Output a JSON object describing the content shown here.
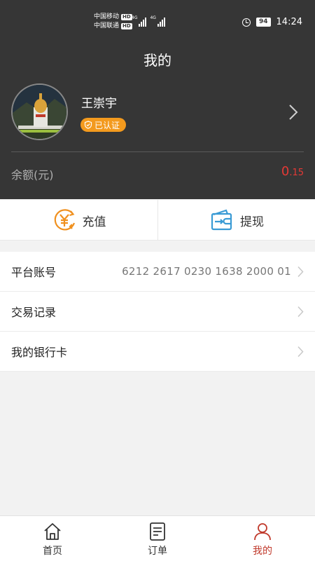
{
  "status_bar": {
    "carrier_1": "中国移动",
    "carrier_2": "中国联通",
    "hd_1": "HD",
    "hd_2": "HD",
    "network_1": "4G",
    "network_2": "4G",
    "battery": "94",
    "time": "14:24"
  },
  "header": {
    "title": "我的"
  },
  "profile": {
    "name": "王崇宇",
    "verified_label": "已认证"
  },
  "balance": {
    "label": "余额(元)",
    "value_int": "0",
    "value_dec": ".15"
  },
  "actions": {
    "recharge_label": "充值",
    "withdraw_label": "提现"
  },
  "menu": {
    "items": [
      {
        "label": "平台账号",
        "value": "6212 2617 0230 1638 2000 01"
      },
      {
        "label": "交易记录"
      },
      {
        "label": "我的银行卡"
      }
    ]
  },
  "tabbar": {
    "tabs": [
      {
        "label": "首页",
        "icon": "home-icon"
      },
      {
        "label": "订单",
        "icon": "order-list-icon"
      },
      {
        "label": "我的",
        "icon": "user-icon",
        "active": true
      }
    ]
  },
  "colors": {
    "header_bg": "#363636",
    "badge": "#f39a1e",
    "balance_red": "#e53935",
    "active_tab": "#c0392b",
    "recharge_orange": "#f0901e",
    "withdraw_blue": "#3a9bd5"
  }
}
